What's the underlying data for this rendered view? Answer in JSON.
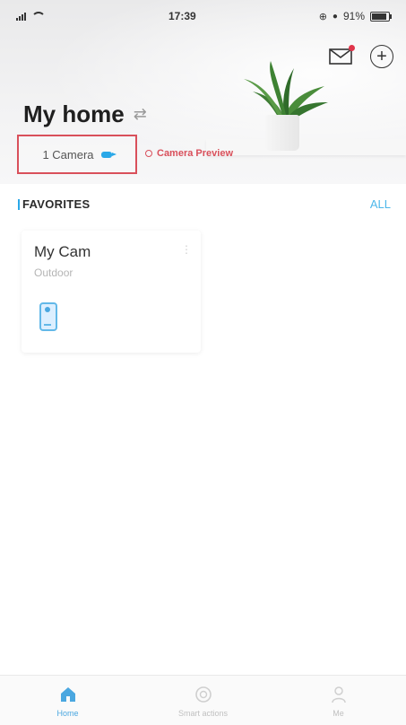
{
  "status_bar": {
    "time": "17:39",
    "battery": "91%"
  },
  "header": {
    "title": "My home",
    "camera_chip": "1 Camera",
    "camera_preview": "Camera Preview"
  },
  "favorites": {
    "title": "FAVORITES",
    "all_label": "ALL",
    "card": {
      "name": "My Cam",
      "location": "Outdoor"
    }
  },
  "bottom_nav": {
    "items": [
      {
        "label": "Home",
        "icon": "home-icon",
        "active": true
      },
      {
        "label": "Smart actions",
        "icon": "smart-actions-icon",
        "active": false
      },
      {
        "label": "Me",
        "icon": "person-icon",
        "active": false
      }
    ]
  },
  "colors": {
    "accent": "#4aa7e0",
    "highlight": "#d9505b"
  }
}
